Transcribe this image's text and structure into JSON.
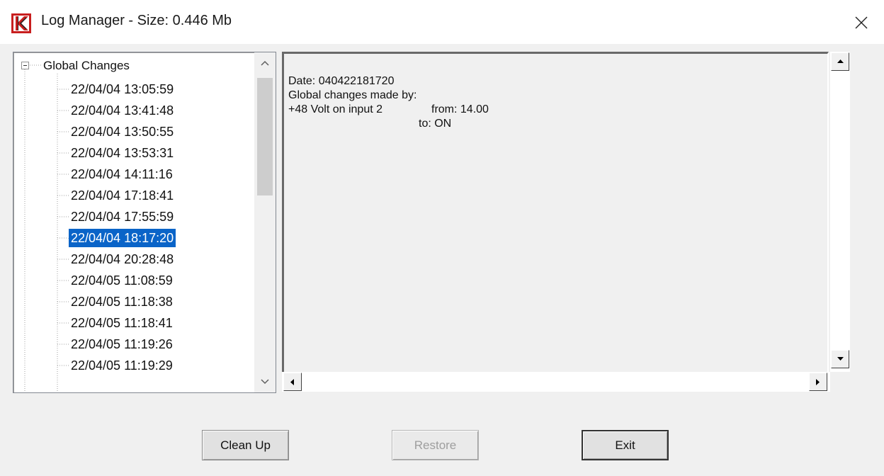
{
  "window": {
    "title": "Log Manager - Size: 0.446 Mb",
    "logo_icon": "app-logo-red-k",
    "close_label": "✕"
  },
  "tree": {
    "root_label": "Global Changes",
    "items": [
      "22/04/04 13:05:59",
      "22/04/04 13:41:48",
      "22/04/04 13:50:55",
      "22/04/04 13:53:31",
      "22/04/04 14:11:16",
      "22/04/04 17:18:41",
      "22/04/04 17:55:59",
      "22/04/04 18:17:20",
      "22/04/04 20:28:48",
      "22/04/05 11:08:59",
      "22/04/05 11:18:38",
      "22/04/05 11:18:41",
      "22/04/05 11:19:26",
      "22/04/05 11:19:29"
    ],
    "selected_index": 7
  },
  "details": {
    "line1": "Date: 040422181720",
    "line2": "Global changes made by:",
    "line3_left": "+48 Volt on input 2",
    "line3_right": "from: 14.00",
    "line4": "to: ON"
  },
  "buttons": {
    "clean_up": "Clean Up",
    "restore": "Restore",
    "exit": "Exit"
  },
  "colors": {
    "selection": "#0a64c8",
    "logo_red": "#c81e1e"
  }
}
